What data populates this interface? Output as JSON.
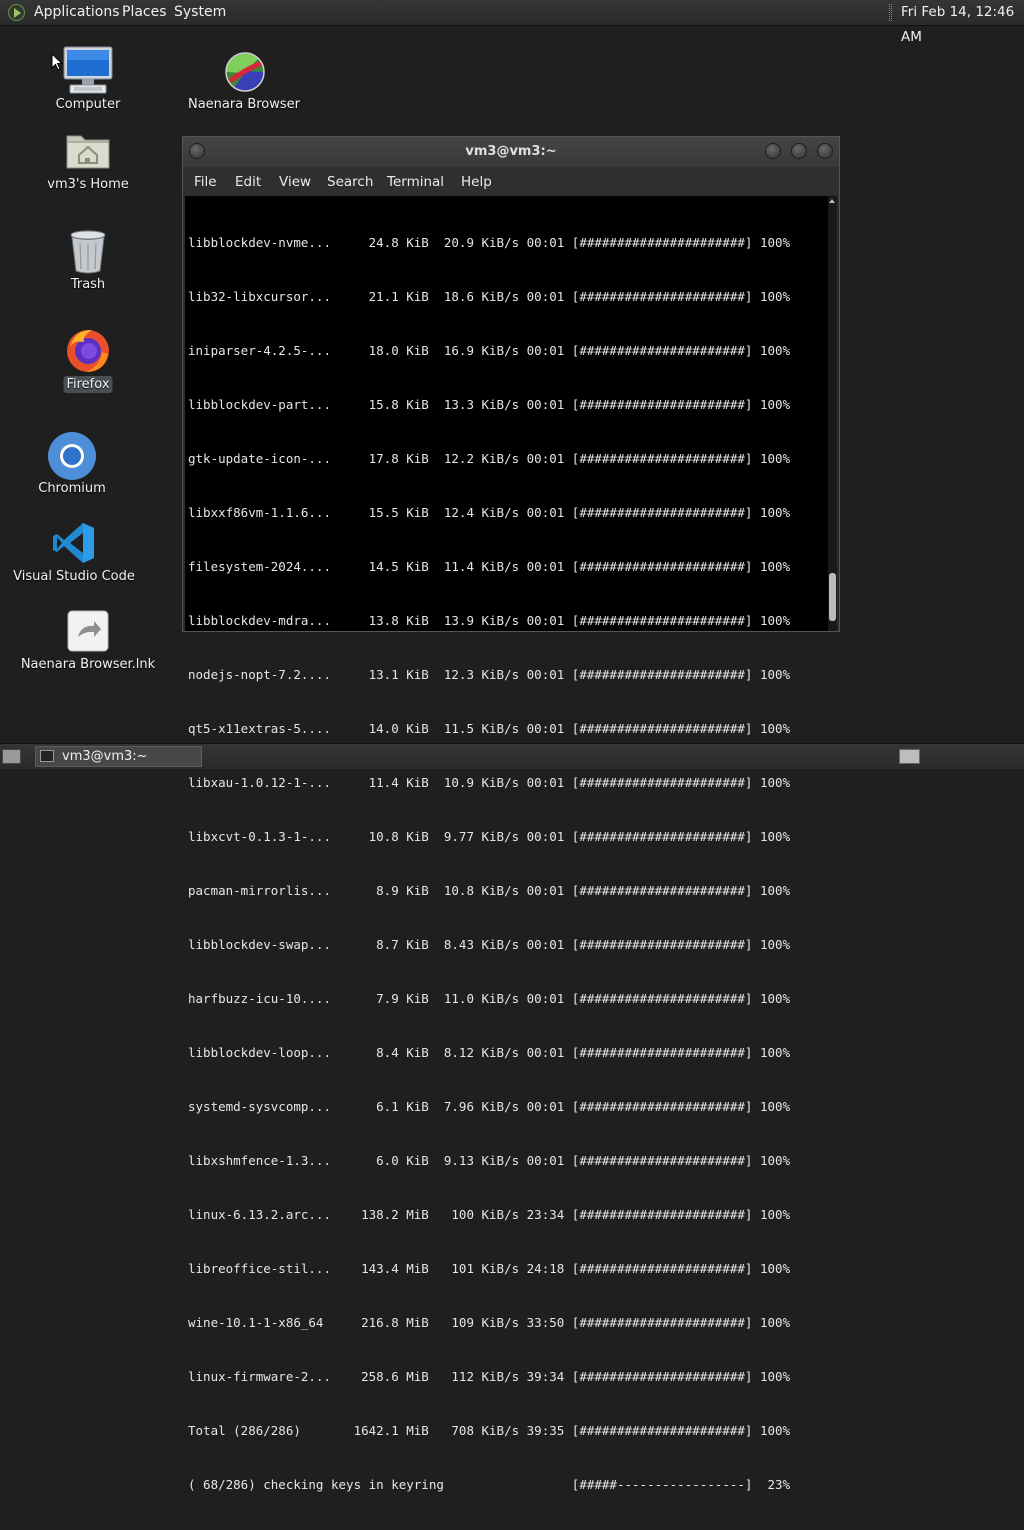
{
  "top_panel": {
    "menus": [
      "Applications",
      "Places",
      "System"
    ],
    "clock": "Fri Feb 14, 12:46 AM"
  },
  "desktop_icons": {
    "computer": "Computer",
    "home": "vm3's Home",
    "trash": "Trash",
    "firefox": "Firefox",
    "chromium": "Chromium",
    "vscode": "Visual Studio Code",
    "naenara": "Naenara Browser",
    "naenara_lnk": "Naenara Browser.lnk"
  },
  "terminal": {
    "title": "vm3@vm3:~",
    "menus": [
      "File",
      "Edit",
      "View",
      "Search",
      "Terminal",
      "Help"
    ],
    "lines": [
      "libblockdev-nvme...     24.8 KiB  20.9 KiB/s 00:01 [######################] 100%",
      "lib32-libxcursor...     21.1 KiB  18.6 KiB/s 00:01 [######################] 100%",
      "iniparser-4.2.5-...     18.0 KiB  16.9 KiB/s 00:01 [######################] 100%",
      "libblockdev-part...     15.8 KiB  13.3 KiB/s 00:01 [######################] 100%",
      "gtk-update-icon-...     17.8 KiB  12.2 KiB/s 00:01 [######################] 100%",
      "libxxf86vm-1.1.6...     15.5 KiB  12.4 KiB/s 00:01 [######################] 100%",
      "filesystem-2024....     14.5 KiB  11.4 KiB/s 00:01 [######################] 100%",
      "libblockdev-mdra...     13.8 KiB  13.9 KiB/s 00:01 [######################] 100%",
      "nodejs-nopt-7.2....     13.1 KiB  12.3 KiB/s 00:01 [######################] 100%",
      "qt5-x11extras-5....     14.0 KiB  11.5 KiB/s 00:01 [######################] 100%",
      "libxau-1.0.12-1-...     11.4 KiB  10.9 KiB/s 00:01 [######################] 100%",
      "libxcvt-0.1.3-1-...     10.8 KiB  9.77 KiB/s 00:01 [######################] 100%",
      "pacman-mirrorlis...      8.9 KiB  10.8 KiB/s 00:01 [######################] 100%",
      "libblockdev-swap...      8.7 KiB  8.43 KiB/s 00:01 [######################] 100%",
      "harfbuzz-icu-10....      7.9 KiB  11.0 KiB/s 00:01 [######################] 100%",
      "libblockdev-loop...      8.4 KiB  8.12 KiB/s 00:01 [######################] 100%",
      "systemd-sysvcomp...      6.1 KiB  7.96 KiB/s 00:01 [######################] 100%",
      "libxshmfence-1.3...      6.0 KiB  9.13 KiB/s 00:01 [######################] 100%",
      "linux-6.13.2.arc...    138.2 MiB   100 KiB/s 23:34 [######################] 100%",
      "libreoffice-stil...    143.4 MiB   101 KiB/s 24:18 [######################] 100%",
      "wine-10.1-1-x86_64     216.8 MiB   109 KiB/s 33:50 [######################] 100%",
      "linux-firmware-2...    258.6 MiB   112 KiB/s 39:34 [######################] 100%",
      "Total (286/286)       1642.1 MiB   708 KiB/s 39:35 [######################] 100%",
      "( 68/286) checking keys in keyring                 [#####-----------------]  23%"
    ]
  },
  "taskbar": {
    "window_title": "vm3@vm3:~"
  }
}
